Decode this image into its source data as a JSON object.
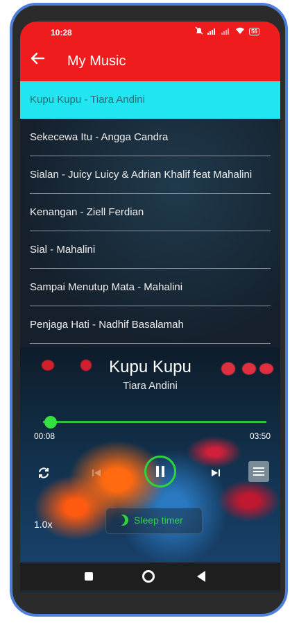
{
  "status_bar": {
    "time": "10:28",
    "battery": "56"
  },
  "app_bar": {
    "back_icon": "arrow-left-icon",
    "title": "My Music"
  },
  "playlist": [
    {
      "label": "Kupu Kupu - Tiara Andini",
      "active": true
    },
    {
      "label": "Sekecewa Itu - Angga Candra",
      "active": false
    },
    {
      "label": "Sialan - Juicy Luicy & Adrian Khalif feat Mahalini",
      "active": false
    },
    {
      "label": "Kenangan - Ziell Ferdian",
      "active": false
    },
    {
      "label": "Sial - Mahalini",
      "active": false
    },
    {
      "label": "Sampai Menutup Mata - Mahalini",
      "active": false
    },
    {
      "label": "Penjaga Hati - Nadhif Basalamah",
      "active": false
    }
  ],
  "player": {
    "song_title": "Kupu Kupu",
    "artist": "Tiara Andini",
    "current_time": "00:08",
    "total_time": "03:50",
    "progress": 0.035,
    "speed": "1.0x",
    "sleep_timer_label": "Sleep timer"
  },
  "colors": {
    "app_bar": "#ee1c1c",
    "active_item": "#21e6f2",
    "accent_green": "#2fd43a"
  }
}
